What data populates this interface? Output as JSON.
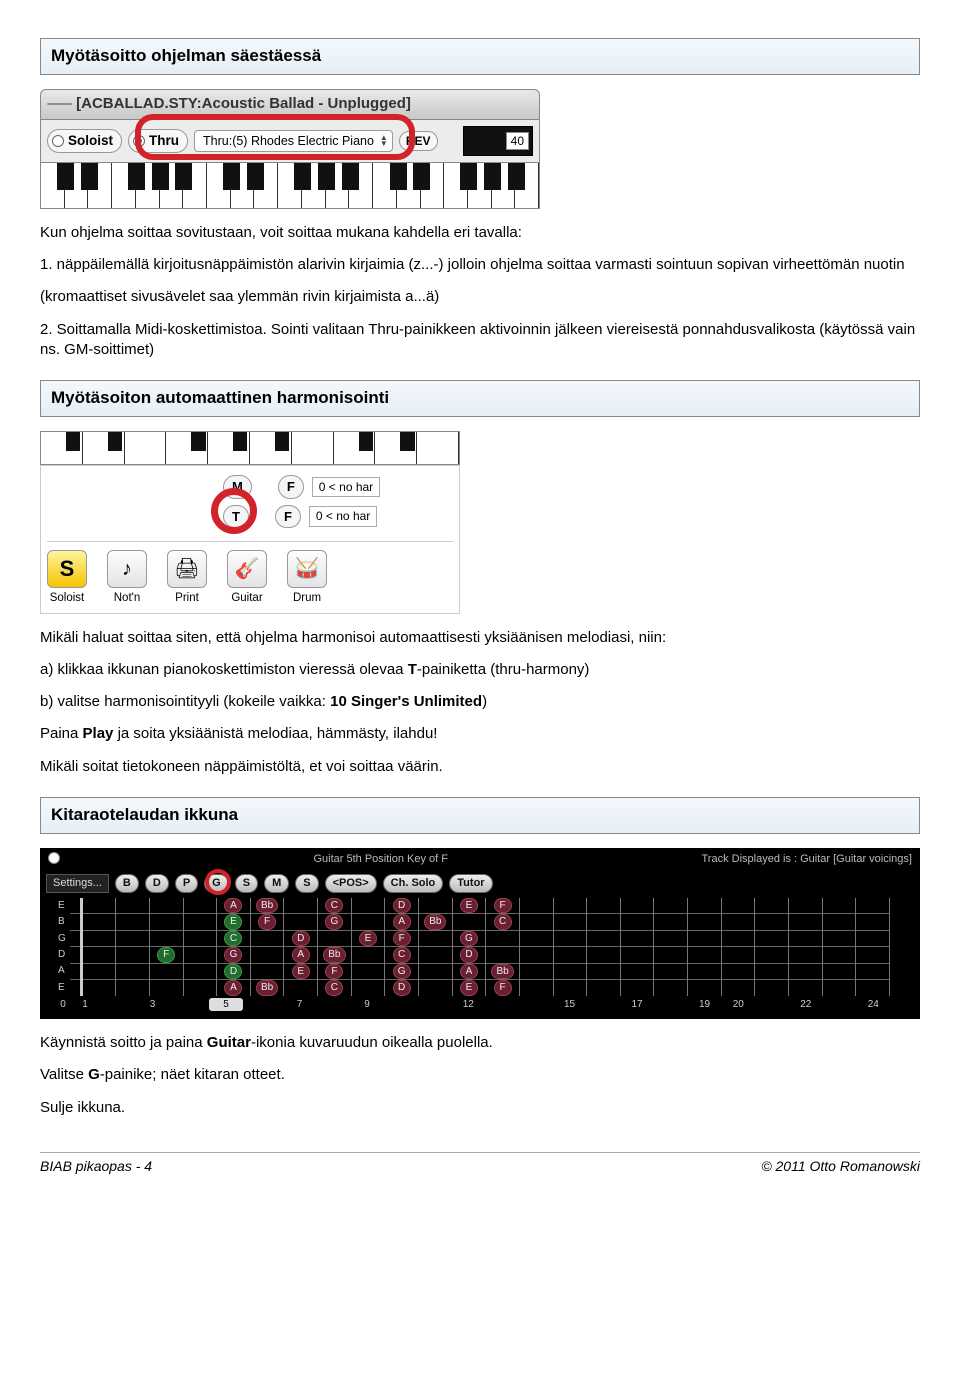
{
  "sections": {
    "s1": {
      "title": "Myötäsoitto ohjelman säestäessä"
    },
    "s2": {
      "title": "Myötäsoiton automaattinen harmonisointi"
    },
    "s3": {
      "title": "Kitaraotelaudan ikkuna"
    }
  },
  "fig1": {
    "tabText": "[ACBALLAD.STY:Acoustic Ballad - Unplugged]",
    "soloist": "Soloist",
    "thru": "Thru",
    "dropdown": "Thru:(5) Rhodes Electric Piano",
    "rev": "REV",
    "revVal": "40"
  },
  "body1": {
    "p1a": "Kun ohjelma soittaa sovitustaan, voit soittaa mukana kahdella eri tavalla:",
    "p1b": "1. näppäilemällä kirjoitusnäppäimistön alarivin kirjaimia (z...-) jolloin ohjelma soittaa varmasti sointuun sopivan virheettömän nuotin",
    "p1c": "(kromaattiset sivusävelet saa ylemmän rivin kirjaimista a...ä)",
    "p1d": "2. Soittamalla Midi-koskettimistoa. Sointi valitaan Thru-painikkeen aktivoinnin jälkeen viereisestä ponnahdusvalikosta (käytössä vain ns. GM-soittimet)"
  },
  "fig2": {
    "m": "M",
    "t": "T",
    "f": "F",
    "noHar": "0 < no har",
    "icons": {
      "soloist": "Soloist",
      "notn": "Not'n",
      "print": "Print",
      "guitar": "Guitar",
      "drum": "Drum"
    }
  },
  "body2": {
    "p1": "Mikäli haluat soittaa siten, että ohjelma harmonisoi automaattisesti yksiäänisen melodiasi, niin:",
    "p2pre": "a) klikkaa ikkunan pianokoskettimiston vieressä olevaa ",
    "p2b": "T",
    "p2post": "-painiketta (thru-harmony)",
    "p3pre": "b) valitse harmonisointityyli (kokeile vaikka: ",
    "p3b": "10 Singer's Unlimited",
    "p3post": ")",
    "p4pre": "Paina ",
    "p4b": "Play",
    "p4post": " ja soita yksiäänistä melodiaa, hämmästy, ilahdu!",
    "p5": "Mikäli soitat tietokoneen näppäimistöltä, et voi soittaa väärin."
  },
  "fig3": {
    "hdrL": "Guitar    5th Position    Key of F",
    "hdrR": "Track Displayed is : Guitar [Guitar voicings]",
    "settings": "Settings...",
    "btns": [
      "B",
      "D",
      "P",
      "G",
      "S",
      "M",
      "S",
      "<POS>",
      "Ch. Solo",
      "Tutor"
    ],
    "strings": [
      "E",
      "B",
      "G",
      "D",
      "A",
      "E"
    ],
    "notes": {
      "1": [
        "",
        "",
        "",
        "",
        "",
        ""
      ],
      "2": [
        "",
        "",
        "",
        "",
        "",
        ""
      ],
      "3": [
        "",
        "",
        "",
        "F",
        "",
        ""
      ],
      "4": [
        "",
        "",
        "",
        "",
        "",
        ""
      ],
      "5": [
        "A",
        "E",
        "C",
        "G",
        "D",
        "A"
      ],
      "6": [
        "Bb",
        "F",
        "",
        "",
        "",
        "Bb"
      ],
      "7": [
        "",
        "",
        "D",
        "A",
        "E",
        ""
      ],
      "8": [
        "C",
        "G",
        "",
        "Bb",
        "F",
        "C"
      ],
      "9": [
        "",
        "",
        "E",
        "",
        "",
        ""
      ],
      "10": [
        "D",
        "A",
        "F",
        "C",
        "G",
        "D"
      ],
      "11": [
        "",
        "Bb",
        "",
        "",
        "",
        ""
      ],
      "12": [
        "E",
        "",
        "G",
        "D",
        "A",
        "E"
      ],
      "13": [
        "F",
        "C",
        "",
        "",
        "Bb",
        "F"
      ]
    },
    "fretnums": [
      "0",
      "1",
      "",
      "3",
      "",
      "5",
      "",
      "7",
      "",
      "9",
      "",
      "",
      "12",
      "",
      "",
      "15",
      "",
      "17",
      "",
      "19",
      "20",
      "",
      "22",
      "",
      "24"
    ]
  },
  "body3": {
    "p1pre": "Käynnistä soitto ja paina ",
    "p1b": "Guitar",
    "p1post": "-ikonia kuvaruudun oikealla puolella.",
    "p2pre": "Valitse ",
    "p2b": "G",
    "p2post": "-painike; näet kitaran otteet.",
    "p3": "Sulje ikkuna."
  },
  "footer": {
    "left": "BIAB pikaopas - 4",
    "right": "© 2011 Otto Romanowski"
  }
}
